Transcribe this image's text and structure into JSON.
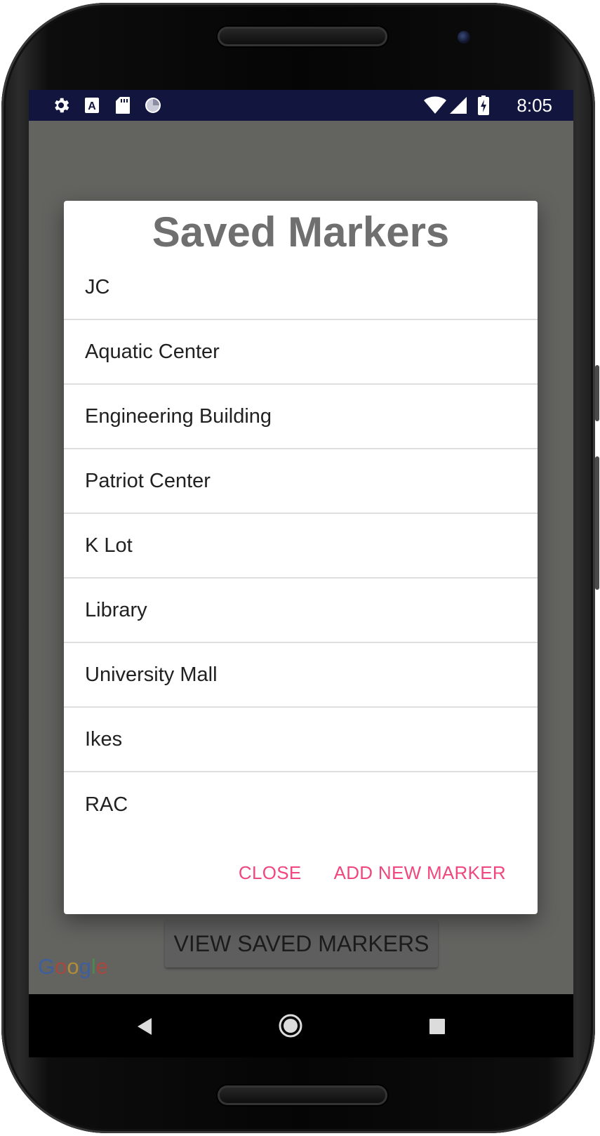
{
  "status_bar": {
    "time": "8:05",
    "left_icons": [
      "gear-icon",
      "text-a-icon",
      "sd-card-icon",
      "sync-progress-icon"
    ],
    "right_icons": [
      "wifi-icon",
      "cell-signal-icon",
      "battery-charging-icon"
    ],
    "background": "#12163f"
  },
  "dialog": {
    "title": "Saved Markers",
    "items": [
      {
        "label": "JC"
      },
      {
        "label": "Aquatic Center"
      },
      {
        "label": "Engineering Building"
      },
      {
        "label": "Patriot Center"
      },
      {
        "label": "K Lot"
      },
      {
        "label": "Library"
      },
      {
        "label": "University Mall"
      },
      {
        "label": "Ikes"
      },
      {
        "label": "RAC"
      }
    ],
    "close_label": "CLOSE",
    "add_label": "ADD NEW MARKER",
    "accent_color": "#f0487e"
  },
  "map": {
    "view_button_label": "VIEW SAVED MARKERS",
    "logo_text": "Google"
  },
  "nav_bar": {
    "icons": [
      "back-icon",
      "home-icon",
      "recents-icon"
    ]
  }
}
